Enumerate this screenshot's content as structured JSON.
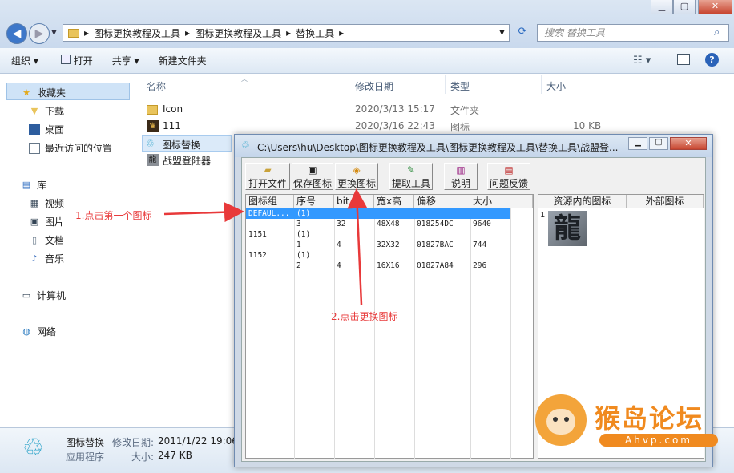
{
  "explorer": {
    "breadcrumb": [
      "图标更换教程及工具",
      "图标更换教程及工具",
      "替换工具"
    ],
    "search_placeholder": "搜索 替换工具",
    "toolbar": {
      "organize": "组织",
      "open": "打开",
      "share": "共享",
      "new_folder": "新建文件夹"
    },
    "sidebar": {
      "favorites": "收藏夹",
      "fav_items": [
        "下载",
        "桌面",
        "最近访问的位置"
      ],
      "libraries": "库",
      "lib_items": [
        "视频",
        "图片",
        "文档",
        "音乐"
      ],
      "computer": "计算机",
      "network": "网络"
    },
    "columns": {
      "name": "名称",
      "date": "修改日期",
      "type": "类型",
      "size": "大小"
    },
    "files": [
      {
        "name": "Icon",
        "date": "2020/3/13 15:17",
        "type": "文件夹",
        "size": ""
      },
      {
        "name": "111",
        "date": "2020/3/16 22:43",
        "type": "图标",
        "size": "10 KB"
      },
      {
        "name": "图标替换",
        "date": "",
        "type": "",
        "size": ""
      },
      {
        "name": "战盟登陆器",
        "date": "",
        "type": "",
        "size": ""
      }
    ],
    "details": {
      "name": "图标替换",
      "date_label": "修改日期:",
      "date": "2011/1/22 19:06",
      "kind": "应用程序",
      "size_label": "大小:",
      "size": "247 KB"
    }
  },
  "dialog": {
    "title": "C:\\Users\\hu\\Desktop\\图标更换教程及工具\\图标更换教程及工具\\替换工具\\战盟登...",
    "buttons": {
      "open": "打开文件",
      "save": "保存图标",
      "replace": "更换图标",
      "extract": "提取工具",
      "help": "说明",
      "feedback": "问题反馈"
    },
    "table": {
      "headers": [
        "图标组",
        "序号",
        "bit",
        "宽x高",
        "偏移",
        "大小"
      ],
      "rows": [
        [
          "DEFAUL...",
          "(1)",
          "",
          "",
          "",
          ""
        ],
        [
          "",
          "3",
          "32",
          "48X48",
          "018254DC",
          "9640"
        ],
        [
          "1151",
          "(1)",
          "",
          "",
          "",
          ""
        ],
        [
          "",
          "1",
          "4",
          "32X32",
          "01827BAC",
          "744"
        ],
        [
          "1152",
          "(1)",
          "",
          "",
          "",
          ""
        ],
        [
          "",
          "2",
          "4",
          "16X16",
          "01827A84",
          "296"
        ]
      ]
    },
    "resource_headers": [
      "资源内的图标",
      "外部图标"
    ],
    "resource_index": "1",
    "icon_glyph": "龍"
  },
  "annotations": {
    "step1": "1.点击第一个图标",
    "step2": "2.点击更换图标"
  },
  "watermark": {
    "text": "猴岛论坛",
    "sub": "Ahvp.com"
  },
  "colors": {
    "accent": "#3399ff",
    "annotation": "#e8393a",
    "watermark": "#f08a1f"
  }
}
